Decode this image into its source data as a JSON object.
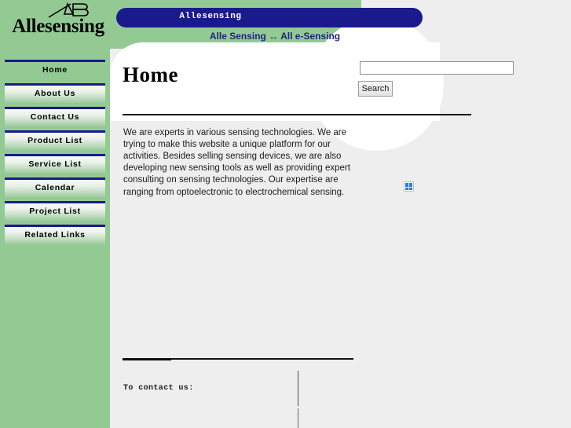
{
  "site": {
    "logo_word": "Allesensing",
    "logo_mark_name": "ab-monogram-icon",
    "banner_title": "Allesensing",
    "tagline": "Alle Sensing ↔ All e-Sensing"
  },
  "colors": {
    "green": "#93c993",
    "navy": "#1a1a8c",
    "tagline_navy": "#23237a",
    "page_gray": "#eeeeee",
    "content_white": "#ffffff"
  },
  "nav": {
    "items": [
      {
        "label": "Home",
        "current": true
      },
      {
        "label": "About Us",
        "current": false
      },
      {
        "label": "Contact Us",
        "current": false
      },
      {
        "label": "Product List",
        "current": false
      },
      {
        "label": "Service List",
        "current": false
      },
      {
        "label": "Calendar",
        "current": false
      },
      {
        "label": "Project List",
        "current": false
      },
      {
        "label": "Related Links",
        "current": false
      }
    ]
  },
  "main": {
    "page_title": "Home",
    "intro_text": "We are experts in various sensing technologies. We are trying to make this website a unique platform for our activities. Besides selling sensing devices, we are also developing new sensing tools as well as providing expert consulting on sensing technologies. Our expertise are ranging from optoelectronic to electrochemical sensing."
  },
  "search": {
    "value": "",
    "placeholder": "",
    "button_label": "Search"
  },
  "footer": {
    "contact_label": "To contact us:"
  }
}
